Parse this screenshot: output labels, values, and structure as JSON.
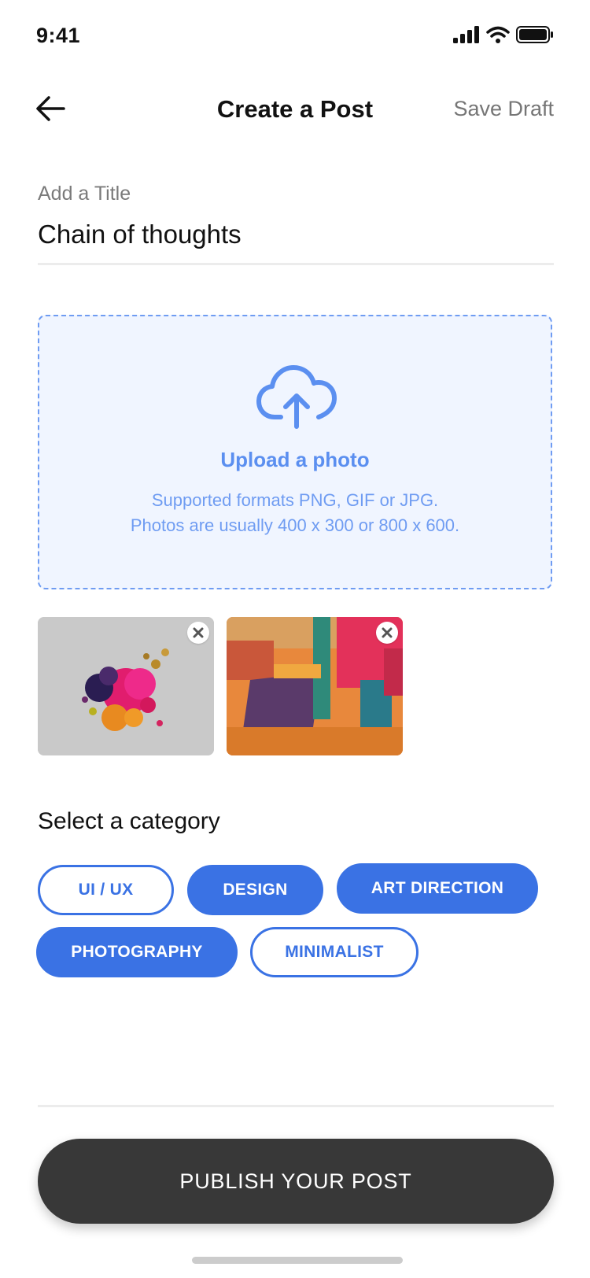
{
  "status_bar": {
    "time": "9:41",
    "icons": [
      "signal-icon",
      "wifi-icon",
      "battery-icon"
    ]
  },
  "header": {
    "back_icon": "arrow-left-icon",
    "title": "Create a Post",
    "save_draft": "Save Draft"
  },
  "title_field": {
    "label": "Add a Title",
    "value": "Chain of thoughts"
  },
  "upload": {
    "icon": "cloud-upload-icon",
    "title": "Upload a photo",
    "desc_line1": "Supported formats PNG, GIF or JPG.",
    "desc_line2": "Photos are usually 400 x 300 or 800 x 600."
  },
  "thumbnails": [
    {
      "name": "paint-splash-photo",
      "remove_icon": "close-icon"
    },
    {
      "name": "abstract-painting-photo",
      "remove_icon": "close-icon"
    }
  ],
  "category": {
    "heading": "Select a category",
    "chips": [
      {
        "label": "UI / UX",
        "selected": false
      },
      {
        "label": "DESIGN",
        "selected": true
      },
      {
        "label": "ART DIRECTION",
        "selected": true
      },
      {
        "label": "PHOTOGRAPHY",
        "selected": true
      },
      {
        "label": "MINIMALIST",
        "selected": false
      }
    ]
  },
  "publish": {
    "label": "PUBLISH YOUR POST"
  },
  "colors": {
    "accent": "#3a72e4",
    "upload_accent": "#5b8ff0",
    "upload_bg": "#f0f5ff",
    "button_dark": "#383838"
  }
}
